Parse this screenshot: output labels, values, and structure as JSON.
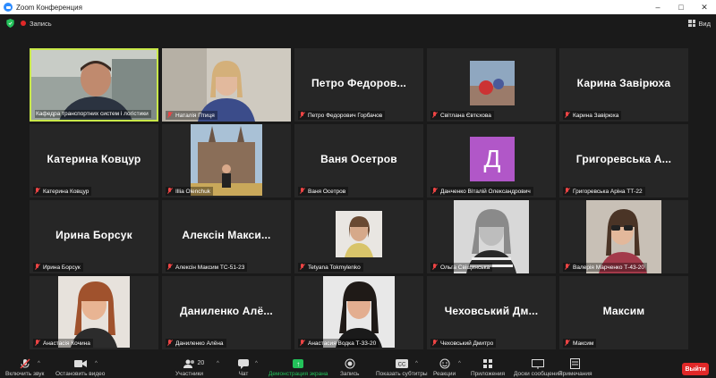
{
  "window": {
    "title": "Zoom Конференция"
  },
  "topbar": {
    "recording_label": "Запись",
    "view_label": "Вид"
  },
  "tiles": [
    {
      "label": "Кафедра транспортних систем і логістики",
      "big": ""
    },
    {
      "label": "Наталія Птиця",
      "big": ""
    },
    {
      "label": "Петро Федорович Горбачов",
      "big": "Петро Федоров..."
    },
    {
      "label": "Світлана Євтєхова",
      "big": ""
    },
    {
      "label": "Карина Завірюха",
      "big": "Карина Завірюха"
    },
    {
      "label": "Катерина Ковцур",
      "big": "Катерина Ковцур"
    },
    {
      "label": "Illia Olenchuk",
      "big": ""
    },
    {
      "label": "Ваня Осетров",
      "big": "Ваня Осетров"
    },
    {
      "label": "Данченко Віталій Олександрович",
      "big": "",
      "avatar": "Д"
    },
    {
      "label": "Григоревська Аріна ТТ-22",
      "big": "Григоревська А..."
    },
    {
      "label": "Ирина Борсук",
      "big": "Ирина Борсук"
    },
    {
      "label": "Алексін Максим ТС-51-23",
      "big": "Алексін Макси..."
    },
    {
      "label": "Tetyana Tokmylenko",
      "big": ""
    },
    {
      "label": "Ольга Свіщинська",
      "big": ""
    },
    {
      "label": "Валерія Марченко Т-43-20",
      "big": ""
    },
    {
      "label": "Анастасія Кочина",
      "big": ""
    },
    {
      "label": "Даниленко Алёна",
      "big": "Даниленко Алё..."
    },
    {
      "label": "Анастасия Водка Т-33-20",
      "big": ""
    },
    {
      "label": "Чеховський Дмитро",
      "big": "Чеховський Дм..."
    },
    {
      "label": "Максим",
      "big": "Максим"
    }
  ],
  "toolbar": {
    "mute": "Включить звук",
    "video": "Остановить видео",
    "participants": "Участники",
    "participants_count": "20",
    "chat": "Чат",
    "share": "Демонстрация экрана",
    "record": "Запись",
    "captions": "Показать субтитры",
    "reactions": "Реакции",
    "apps": "Приложения",
    "whiteboard": "Доски сообщений",
    "notes": "Примечания",
    "exit": "Выйти"
  },
  "colors": {
    "accent_active": "#c9e84a",
    "share_green": "#23c25a",
    "exit_red": "#e02828",
    "avatar_purple": "#b157c8"
  }
}
